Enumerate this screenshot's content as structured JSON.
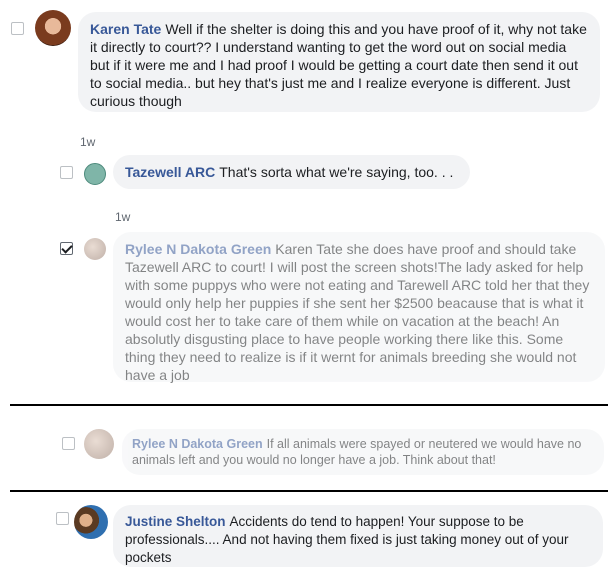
{
  "comments": [
    {
      "author": "Karen Tate",
      "text": "Well if the shelter is doing this and you have proof of it, why not take it directly to court?? I understand wanting to get the word out on social media but if it were me and I had proof I would be getting a court date then send it out to social media.. but hey that's just me and I realize everyone is different. Just curious though",
      "time": "1w",
      "checked": false
    },
    {
      "author": "Tazewell ARC",
      "text": "That's sorta what we're saying, too. . .",
      "time": "1w",
      "checked": false
    },
    {
      "author": "Rylee N Dakota Green",
      "text": "Karen Tate she does have proof and should take Tazewell ARC to court! I will post the screen shots!The lady asked for help with some puppys who were not eating and Tarewell ARC told her that they would only help her puppies if she sent her $2500 beacause that is what it would cost her to take care of them while on vacation at the beach! An absolutly disgusting place to have people working there like this. Some thing they need to realize is if it wernt for animals breeding she would not have a job",
      "checked": true
    },
    {
      "author": "Rylee N Dakota Green",
      "text": "If all animals were spayed or neutered we would have no animals left and you would no longer have a job. Think about that!",
      "checked": false
    },
    {
      "author": "Justine Shelton",
      "text": "Accidents do tend to happen! Your suppose to be professionals.... And not having them fixed is just taking money out of your pockets",
      "checked": false
    }
  ],
  "colors": {
    "author_name": "#385898",
    "bubble_bg": "#f2f3f5",
    "timestamp": "#606770"
  },
  "icons": [
    "checkbox",
    "checkbox-checked",
    "avatar"
  ]
}
